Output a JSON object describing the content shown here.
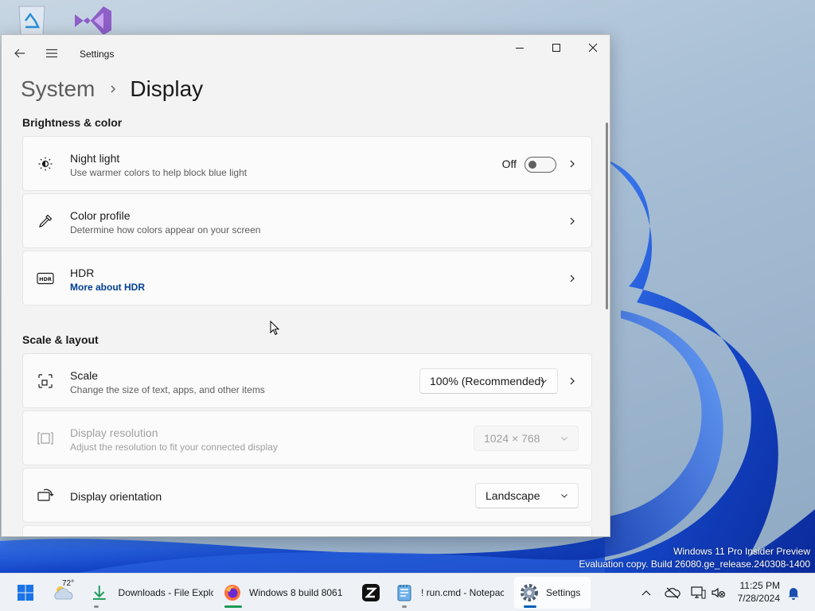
{
  "window": {
    "app_title": "Settings",
    "minimize_label": "Minimize",
    "maximize_label": "Maximize",
    "close_label": "Close"
  },
  "breadcrumb": {
    "parent": "System",
    "current": "Display"
  },
  "sections": {
    "brightness": {
      "title": "Brightness & color",
      "night_light": {
        "title": "Night light",
        "subtitle": "Use warmer colors to help block blue light",
        "state_text": "Off",
        "enabled": false
      },
      "color_profile": {
        "title": "Color profile",
        "subtitle": "Determine how colors appear on your screen"
      },
      "hdr": {
        "title": "HDR",
        "link": "More about HDR"
      }
    },
    "scale_layout": {
      "title": "Scale & layout",
      "scale": {
        "title": "Scale",
        "subtitle": "Change the size of text, apps, and other items",
        "value": "100% (Recommended)"
      },
      "resolution": {
        "title": "Display resolution",
        "subtitle": "Adjust the resolution to fit your connected display",
        "value": "1024 × 768",
        "disabled": true
      },
      "orientation": {
        "title": "Display orientation",
        "value": "Landscape"
      }
    }
  },
  "desktop": {
    "watermark_line1": "Windows 11 Pro Insider Preview",
    "watermark_line2": "Evaluation copy. Build 26080.ge_release.240308-1400"
  },
  "taskbar": {
    "weather_temp": "72°",
    "apps": [
      {
        "label": "Downloads - File Explc",
        "icon": "download-arrow-icon"
      },
      {
        "label": "Windows 8 build 8061",
        "icon": "firefox-icon"
      },
      {
        "label": "",
        "icon": "z-app-icon"
      },
      {
        "label": "! run.cmd - Notepac",
        "icon": "notepad-icon"
      },
      {
        "label": "Settings",
        "icon": "gear-icon"
      }
    ],
    "time": "11:25 PM",
    "date": "7/28/2024"
  },
  "colors": {
    "accent": "#005fb8",
    "link": "#003e92",
    "window_bg": "#f3f3f3",
    "card_bg": "#fbfbfb"
  }
}
